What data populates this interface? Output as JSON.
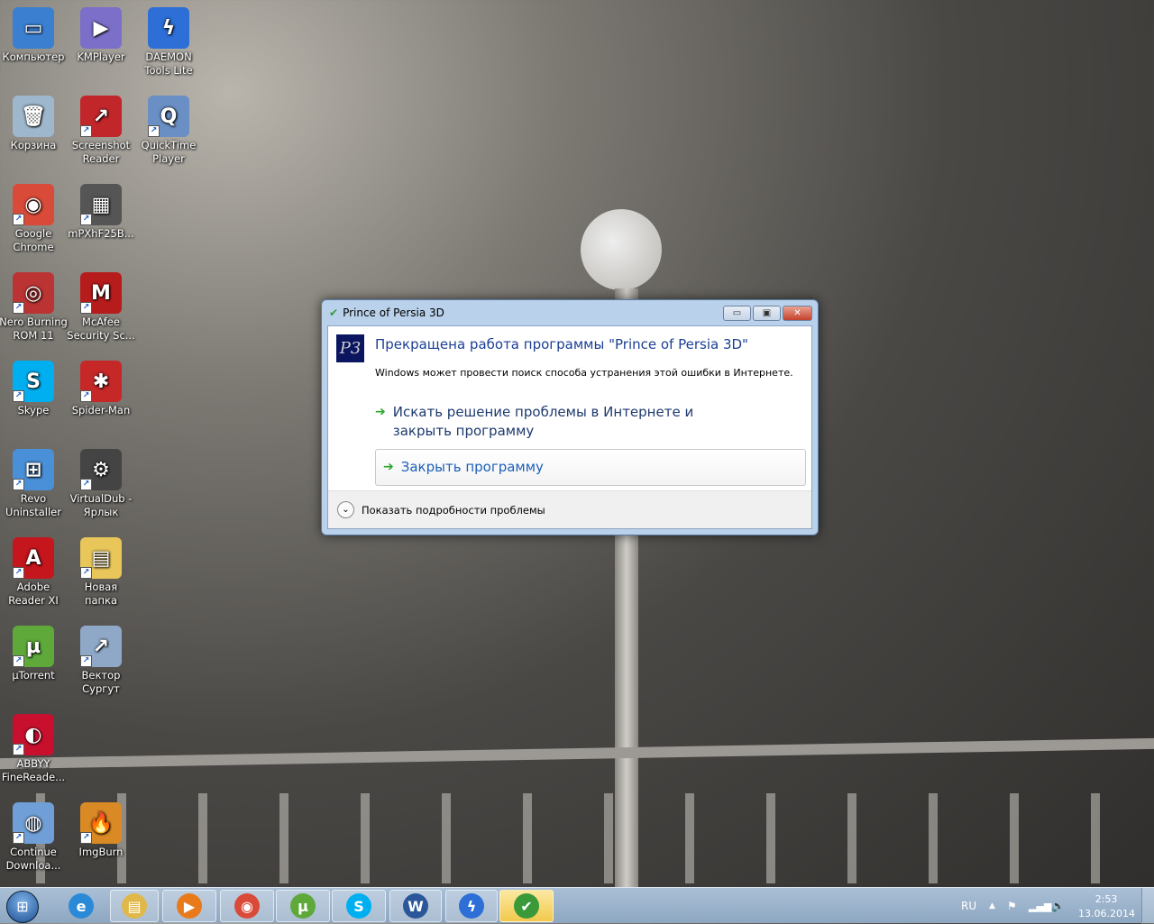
{
  "desktop_icons": [
    {
      "label": "Компьютер",
      "color": "#3b7fd1",
      "glyph": "▭"
    },
    {
      "label": "KMPlayer",
      "color": "#7b6fc9",
      "glyph": "▶"
    },
    {
      "label": "DAEMON Tools Lite",
      "color": "#2d6fd6",
      "glyph": "ϟ"
    },
    {
      "label": "Корзина",
      "color": "#9fb7cc",
      "glyph": "🗑"
    },
    {
      "label": "Screenshot Reader",
      "color": "#c0262a",
      "glyph": "↗"
    },
    {
      "label": "QuickTime Player",
      "color": "#6a8fc4",
      "glyph": "Q"
    },
    {
      "label": "Google Chrome",
      "color": "#d94a38",
      "glyph": "◉"
    },
    {
      "label": "mPXhF25B...",
      "color": "#555",
      "glyph": "▦"
    },
    {
      "label": "Nero Burning ROM 11",
      "color": "#b33",
      "glyph": "◎"
    },
    {
      "label": "McAfee Security Sc...",
      "color": "#b71c1c",
      "glyph": "M"
    },
    {
      "label": "Skype",
      "color": "#00aff0",
      "glyph": "S"
    },
    {
      "label": "Spider-Man",
      "color": "#c62828",
      "glyph": "✱"
    },
    {
      "label": "Revo Uninstaller",
      "color": "#4a90d9",
      "glyph": "⊞"
    },
    {
      "label": "VirtualDub - Ярлык",
      "color": "#444",
      "glyph": "⚙"
    },
    {
      "label": "Adobe Reader XI",
      "color": "#c4161c",
      "glyph": "A"
    },
    {
      "label": "Новая папка",
      "color": "#e8c65a",
      "glyph": "▤"
    },
    {
      "label": "µTorrent",
      "color": "#5ea93a",
      "glyph": "µ"
    },
    {
      "label": "Вектор Сургут",
      "color": "#8fa8c8",
      "glyph": "↗"
    },
    {
      "label": "ABBYY FineReade...",
      "color": "#c8102e",
      "glyph": "◐"
    },
    {
      "label": "Continue Downloa...",
      "color": "#6f9fd6",
      "glyph": "◍"
    },
    {
      "label": "ImgBurn",
      "color": "#d98a24",
      "glyph": "🔥"
    }
  ],
  "dialog": {
    "title": "Prince of Persia 3D",
    "minimize": "▭",
    "maximize": "▣",
    "close": "✕",
    "heading": "Прекращена работа программы \"Prince of Persia 3D\"",
    "description": "Windows может провести поиск способа устранения этой ошибки в Интернете.",
    "option_search": "Искать решение проблемы в Интернете и закрыть программу",
    "option_close": "Закрыть программу",
    "details": "Показать подробности проблемы",
    "arrow": "➔"
  },
  "taskbar": {
    "buttons": [
      {
        "name": "internet-explorer",
        "glyph": "e",
        "color": "#2b8ad8"
      },
      {
        "name": "windows-explorer",
        "glyph": "▤",
        "color": "#e0b84a"
      },
      {
        "name": "media-player",
        "glyph": "▶",
        "color": "#e87a1c"
      },
      {
        "name": "chrome",
        "glyph": "◉",
        "color": "#d94a38"
      },
      {
        "name": "utorrent",
        "glyph": "µ",
        "color": "#5ea93a"
      },
      {
        "name": "skype",
        "glyph": "S",
        "color": "#00aff0"
      },
      {
        "name": "word",
        "glyph": "W",
        "color": "#2b579a"
      },
      {
        "name": "daemon-tools",
        "glyph": "ϟ",
        "color": "#2d6fd6"
      },
      {
        "name": "problem-reporting",
        "glyph": "✔",
        "color": "#3a9a3a"
      }
    ],
    "language": "RU",
    "time": "2:53",
    "date": "13.06.2014"
  }
}
